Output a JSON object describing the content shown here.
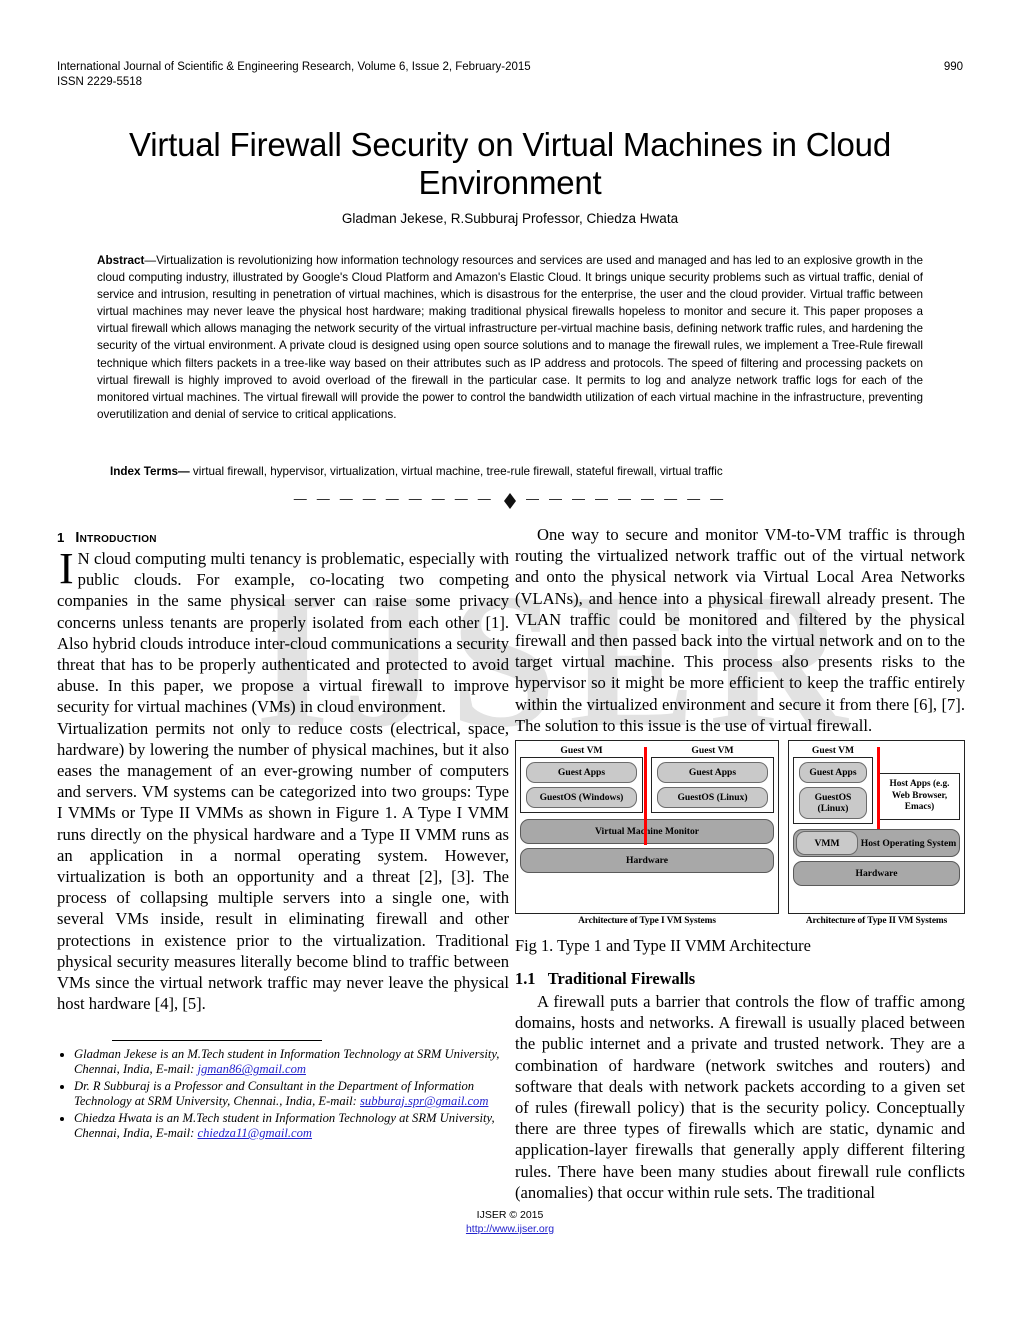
{
  "runhead": {
    "journal_line": "International Journal of Scientific & Engineering Research, Volume 6, Issue 2, February-2015",
    "page_number": "990",
    "issn": "ISSN 2229-5518"
  },
  "title": "Virtual Firewall Security on Virtual Machines in Cloud Environment",
  "authors": "Gladman Jekese, R.Subburaj Professor, Chiedza Hwata",
  "abstract": {
    "label": "Abstract",
    "dash": "—",
    "text": "Virtualization is revolutionizing how information technology resources and services are used and managed and has led to an explosive growth in the cloud computing industry, illustrated by Google's Cloud Platform and Amazon's Elastic Cloud. It brings unique security problems such as virtual traffic, denial of service and intrusion, resulting in penetration of virtual machines, which is disastrous for the enterprise, the user and the cloud provider. Virtual traffic between virtual machines may never leave the physical host hardware; making traditional physical firewalls hopeless to monitor and secure it. This paper proposes a virtual firewall which allows managing the network security of the virtual infrastructure per-virtual machine basis, defining network traffic rules, and hardening the security of the virtual environment. A private cloud is designed using open source solutions and to manage the firewall rules, we implement a Tree-Rule firewall technique which filters packets in a tree-like way based on their attributes such as IP address and protocols. The speed of filtering and processing packets on virtual firewall is highly improved to avoid overload of the firewall in the particular case. It permits to log and analyze network traffic logs for each of the monitored virtual machines. The virtual firewall will provide the power to control the bandwidth utilization of each virtual machine in the infrastructure, preventing overutilization and denial of service to critical applications."
  },
  "index_terms": {
    "label": "Index Terms—",
    "terms": "virtual firewall, hypervisor, virtualization, virtual machine, tree-rule firewall, stateful firewall, virtual traffic"
  },
  "divider": {
    "left_dashes": "— — — — — — — — —",
    "right_dashes": "— — — — — — — — —"
  },
  "watermark": "IJSER",
  "left_column": {
    "section_number": "1",
    "section_title": "Introduction",
    "dropcap": "I",
    "para1": "N cloud computing multi tenancy is problematic, especially with public clouds. For example, co-locating two competing companies in the same physical server can raise some privacy concerns unless tenants are properly isolated from each other [1]. Also hybrid clouds introduce inter-cloud communications a security threat that has to be properly authenticated and protected to avoid abuse.  In this paper, we propose a virtual firewall to improve security for virtual machines (VMs) in cloud environment.",
    "para2": "Virtualization permits not only to reduce costs (electrical, space, hardware) by lowering the number of physical machines, but it also eases the management of an ever-growing number of computers and servers. VM systems can be categorized into two groups: Type I VMMs or Type II VMMs as shown in Figure 1. A Type I VMM runs directly on the physical hardware and a Type II VMM runs as an application in a normal operating system. However, virtualization is both an opportunity and a threat [2], [3]. The process of collapsing multiple servers into a single one, with several VMs inside, result in eliminating firewall and other protections in existence prior to the virtualization. Traditional physical security measures literally become blind to traffic between VMs since the virtual network traffic may never leave the physical host hardware [4], [5]."
  },
  "right_column": {
    "para1": "One way to secure and monitor VM-to-VM traffic is through routing the virtualized network traffic out of the virtual network and onto the physical network via Virtual Local Area Networks (VLANs), and hence into a physical firewall already present. The VLAN traffic could be monitored and filtered by the physical firewall and then passed back into the virtual network and on to the target virtual machine.  This process also presents risks to the hypervisor so it might be more efficient to keep the traffic entirely within the virtualized environment and secure it from there [6], [7]. The solution to this issue is the use of virtual firewall.",
    "figure_caption": "Fig 1. Type 1 and Type II VMM Architecture",
    "subsection_number": "1.1",
    "subsection_title": "Traditional Firewalls",
    "para2": "A firewall puts a barrier that controls the flow of traffic among domains, hosts and networks. A firewall is usually placed between the public internet and a private and trusted network. They are a combination of hardware (network switches and routers) and software that deals with network packets according to a given set of rules (firewall policy) that is the security policy. Conceptually there are three types of firewalls which are static, dynamic and application-layer firewalls that generally apply different filtering rules. There have been many studies about firewall rule conflicts (anomalies) that occur within rule sets. The traditional"
  },
  "figure": {
    "type1": {
      "caption": "Architecture of Type I VM Systems",
      "vm_left_label": "Guest VM",
      "vm_right_label": "Guest VM",
      "vm_left_apps": "Guest Apps",
      "vm_left_os": "GuestOS (Windows)",
      "vm_right_apps": "Guest Apps",
      "vm_right_os": "GuestOS (Linux)",
      "vmm": "Virtual Machine Monitor",
      "hardware": "Hardware"
    },
    "type2": {
      "caption": "Architecture of Type II VM Systems",
      "vm_label": "Guest VM",
      "guest_apps": "Guest Apps",
      "guest_os": "GuestOS (Linux)",
      "host_apps": "Host Apps (e.g. Web Browser, Emacs)",
      "vmm": "VMM",
      "host_os": "Host Operating System",
      "hardware": "Hardware"
    },
    "divider_color": "#ff0000"
  },
  "footnotes": [
    {
      "text_before": "Gladman Jekese is an M.Tech student in Information Technology at SRM University, Chennai, India,  E-mail: ",
      "email": "jgman86@gmail.com"
    },
    {
      "text_before": "Dr. R Subburaj is a Professor and Consultant in the Department of Information Technology at SRM University, Chennai., India, E-mail: ",
      "email": "subburaj.spr@gmail.com"
    },
    {
      "text_before": "Chiedza Hwata is an M.Tech student in Information Technology at SRM University, Chennai, India,  E-mail: ",
      "email": "chiedza11@gmail.com"
    }
  ],
  "page_footer": {
    "copyright": "IJSER © 2015",
    "url": "http://www.ijser.org"
  }
}
